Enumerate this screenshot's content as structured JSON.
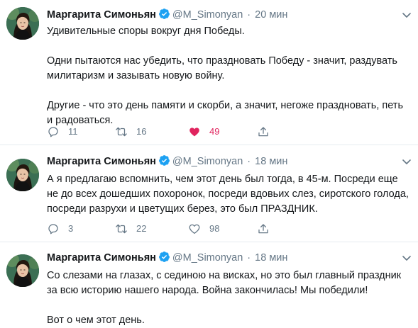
{
  "colors": {
    "verified": "#1da1f2",
    "like_active": "#e0245e",
    "muted": "#657786",
    "text": "#14171a"
  },
  "tweets": [
    {
      "author": "Маргарита Симоньян",
      "handle": "@M_Simonyan",
      "time": "20 мин",
      "paragraphs": [
        "Удивительные споры вокруг дня Победы.",
        "Одни пытаются нас убедить, что праздновать Победу - значит, раздувать милитаризм и зазывать новую войну.",
        "Другие - что это день памяти и скорби, а значит, негоже праздновать, петь и радоваться."
      ],
      "replies": "11",
      "retweets": "16",
      "likes": "49",
      "liked": true
    },
    {
      "author": "Маргарита Симоньян",
      "handle": "@M_Simonyan",
      "time": "18 мин",
      "paragraphs": [
        "А я предлагаю вспомнить, чем этот день был тогда, в 45-м. Посреди еще не до всех дошедших похоронок, посреди вдовьих слез, сиротского голода, посреди разрухи и цветущих берез, это был ПРАЗДНИК."
      ],
      "replies": "3",
      "retweets": "22",
      "likes": "98",
      "liked": false
    },
    {
      "author": "Маргарита Симоньян",
      "handle": "@M_Simonyan",
      "time": "18 мин",
      "paragraphs": [
        "Со слезами на глазах, с сединою на висках, но это был главный праздник за всю историю нашего народа. Война закончилась! Мы победили!",
        "Вот о чем этот день."
      ]
    }
  ],
  "icons": {
    "verified": "verified-badge-icon",
    "menu": "chevron-down-icon",
    "reply": "reply-bubble-icon",
    "retweet": "retweet-icon",
    "like": "heart-icon",
    "share": "share-upload-icon"
  }
}
